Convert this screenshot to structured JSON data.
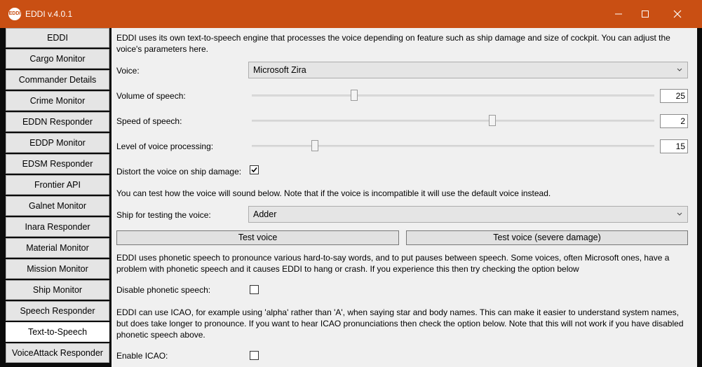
{
  "window": {
    "title": "EDDI v.4.0.1",
    "icon_text": "EDDI",
    "accent_color": "#c94f13"
  },
  "sidebar": {
    "items": [
      {
        "label": "EDDI"
      },
      {
        "label": "Cargo Monitor"
      },
      {
        "label": "Commander Details"
      },
      {
        "label": "Crime Monitor"
      },
      {
        "label": "EDDN Responder"
      },
      {
        "label": "EDDP Monitor"
      },
      {
        "label": "EDSM Responder"
      },
      {
        "label": "Frontier API"
      },
      {
        "label": "Galnet Monitor"
      },
      {
        "label": "Inara Responder"
      },
      {
        "label": "Material Monitor"
      },
      {
        "label": "Mission Monitor"
      },
      {
        "label": "Ship Monitor"
      },
      {
        "label": "Speech Responder"
      },
      {
        "label": "Text-to-Speech",
        "selected": true
      },
      {
        "label": "VoiceAttack Responder"
      }
    ]
  },
  "tts": {
    "intro": "EDDI uses its own text-to-speech engine that processes the voice depending on feature such as ship damage and size of cockpit. You can adjust the voice's parameters here.",
    "voice_label": "Voice:",
    "voice_value": "Microsoft Zira",
    "volume_label": "Volume of speech:",
    "volume_value": "25",
    "volume_fraction": 0.25,
    "speed_label": "Speed of speech:",
    "speed_value": "2",
    "speed_fraction": 0.6,
    "processing_label": "Level of voice processing:",
    "processing_value": "15",
    "processing_fraction": 0.15,
    "distort_label": "Distort the voice on ship damage:",
    "distort_checked": true,
    "test_note": "You can test how the voice will sound below. Note that if the voice is incompatible it will use the default voice instead.",
    "ship_label": "Ship for testing the voice:",
    "ship_value": "Adder",
    "test_button": "Test voice",
    "test_damage_button": "Test voice (severe damage)",
    "phonetic_note": "EDDI uses phonetic speech to pronounce various hard-to-say words, and to put pauses between speech. Some voices, often Microsoft ones, have a problem with phonetic speech and it causes EDDI to hang or crash. If you experience this then try checking the option below",
    "phonetic_label": "Disable phonetic speech:",
    "phonetic_checked": false,
    "icao_note": "EDDI can use ICAO, for example using 'alpha' rather than 'A', when saying star and body names. This can make it easier to understand system names, but does take longer to pronounce. If you want to hear ICAO pronunciations then check the option below. Note that this will not work if you have disabled phonetic speech above.",
    "icao_label": "Enable ICAO:",
    "icao_checked": false
  }
}
